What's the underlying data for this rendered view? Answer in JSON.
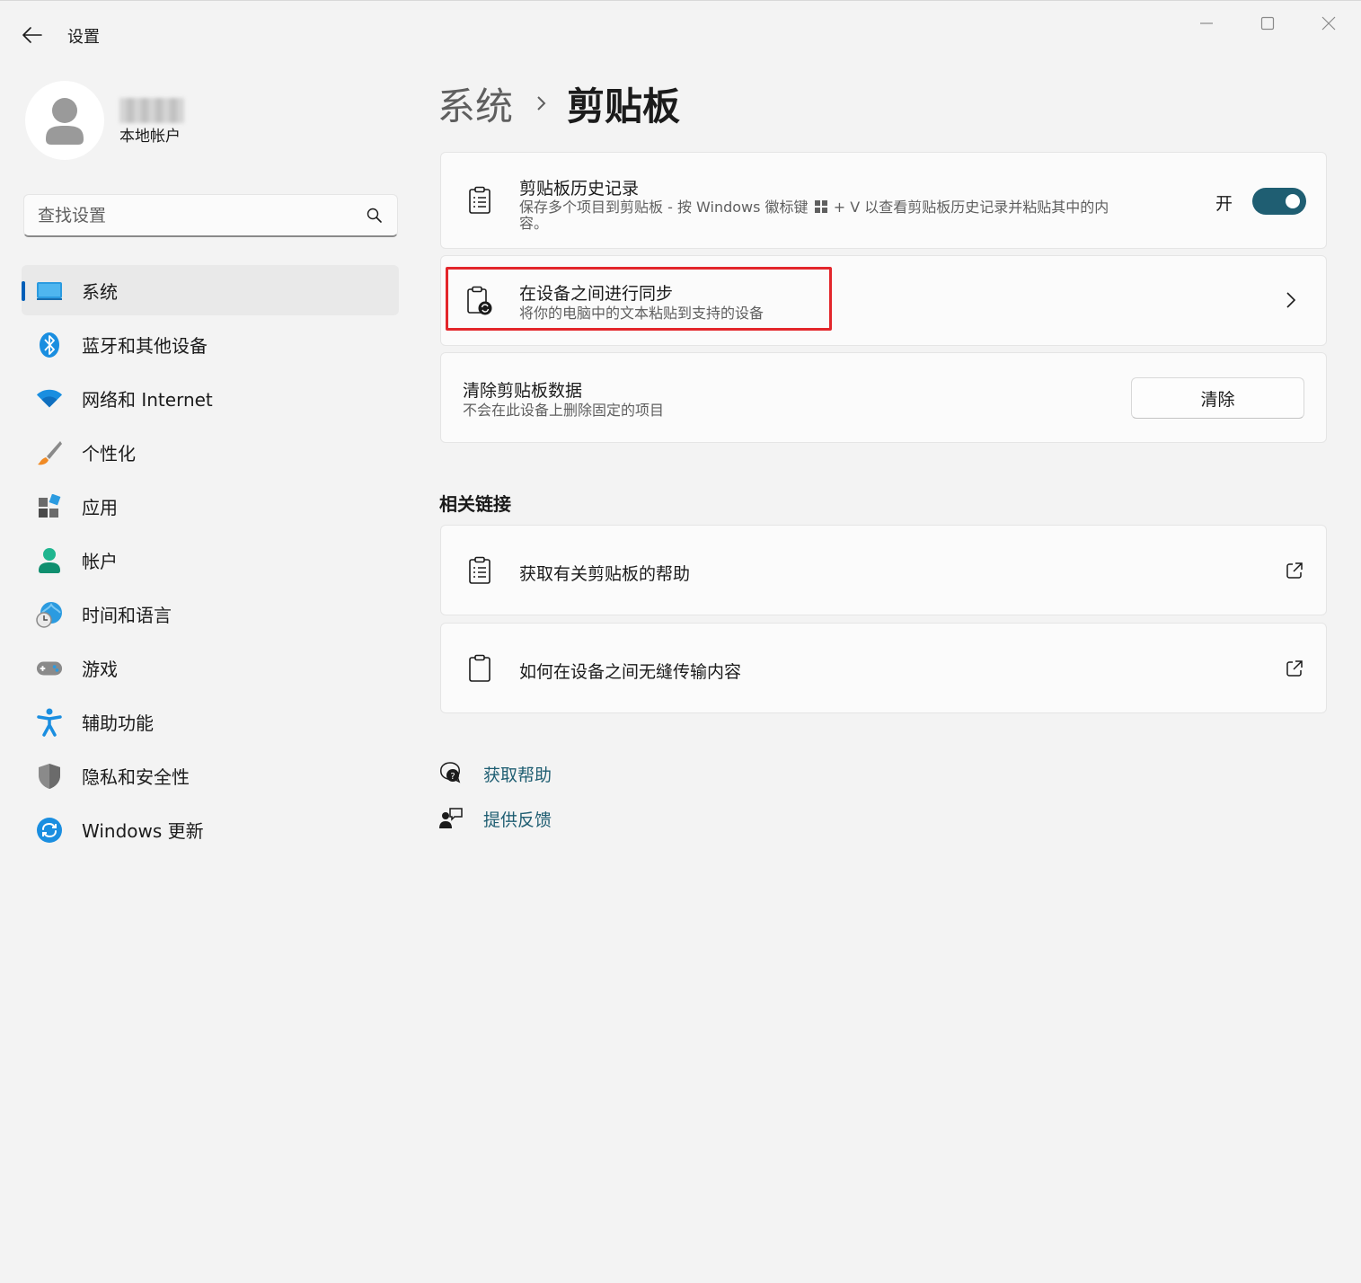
{
  "app": {
    "title": "设置"
  },
  "profile": {
    "account_type": "本地帐户"
  },
  "search": {
    "placeholder": "查找设置"
  },
  "sidebar": {
    "items": [
      {
        "label": "系统",
        "icon": "monitor-icon",
        "active": true
      },
      {
        "label": "蓝牙和其他设备",
        "icon": "bluetooth-icon"
      },
      {
        "label": "网络和 Internet",
        "icon": "wifi-icon"
      },
      {
        "label": "个性化",
        "icon": "paintbrush-icon"
      },
      {
        "label": "应用",
        "icon": "apps-icon"
      },
      {
        "label": "帐户",
        "icon": "account-icon"
      },
      {
        "label": "时间和语言",
        "icon": "globe-clock-icon"
      },
      {
        "label": "游戏",
        "icon": "gamepad-icon"
      },
      {
        "label": "辅助功能",
        "icon": "accessibility-icon"
      },
      {
        "label": "隐私和安全性",
        "icon": "shield-icon"
      },
      {
        "label": "Windows 更新",
        "icon": "update-icon"
      }
    ]
  },
  "breadcrumb": {
    "parent": "系统",
    "current": "剪贴板"
  },
  "clipboard_history": {
    "title": "剪贴板历史记录",
    "description_line1": "保存多个项目到剪贴板 - 按 Windows 徽标键",
    "description_line1b": "+ V 以查看剪贴板历史记录并粘贴其中的内",
    "description_line2": "容。",
    "toggle_label": "开",
    "toggle_on": true
  },
  "sync_devices": {
    "title": "在设备之间进行同步",
    "description": "将你的电脑中的文本粘贴到支持的设备"
  },
  "clear_data": {
    "title": "清除剪贴板数据",
    "description": "不会在此设备上删除固定的项目",
    "button_label": "清除"
  },
  "related_links": {
    "heading": "相关链接",
    "items": [
      {
        "label": "获取有关剪贴板的帮助"
      },
      {
        "label": "如何在设备之间无缝传输内容"
      }
    ]
  },
  "footer_links": {
    "help": "获取帮助",
    "feedback": "提供反馈"
  },
  "colors": {
    "accent": "#1f5e72",
    "nav_indicator": "#005fb8",
    "highlight": "#e3262b"
  }
}
